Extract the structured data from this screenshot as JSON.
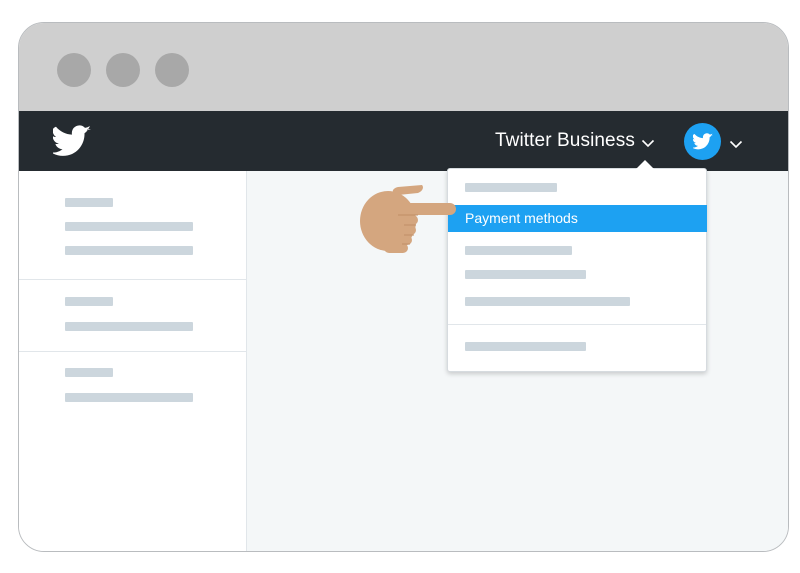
{
  "window": {
    "controls": [
      "close",
      "minimize",
      "maximize"
    ]
  },
  "navbar": {
    "logo_icon": "twitter-bird-icon",
    "account_switcher_label": "Twitter Business",
    "account_chevron_icon": "chevron-down-icon",
    "avatar_icon": "twitter-bird-icon",
    "avatar_chevron_icon": "chevron-down-icon"
  },
  "dropdown": {
    "highlighted_item": "Payment methods"
  },
  "pointer": {
    "icon": "pointing-hand-icon"
  },
  "colors": {
    "navbar": "#252b30",
    "accent": "#1da1f2",
    "placeholder": "#ccd6dd",
    "main_bg": "#f4f7f8",
    "hand": "#d4a67f"
  }
}
